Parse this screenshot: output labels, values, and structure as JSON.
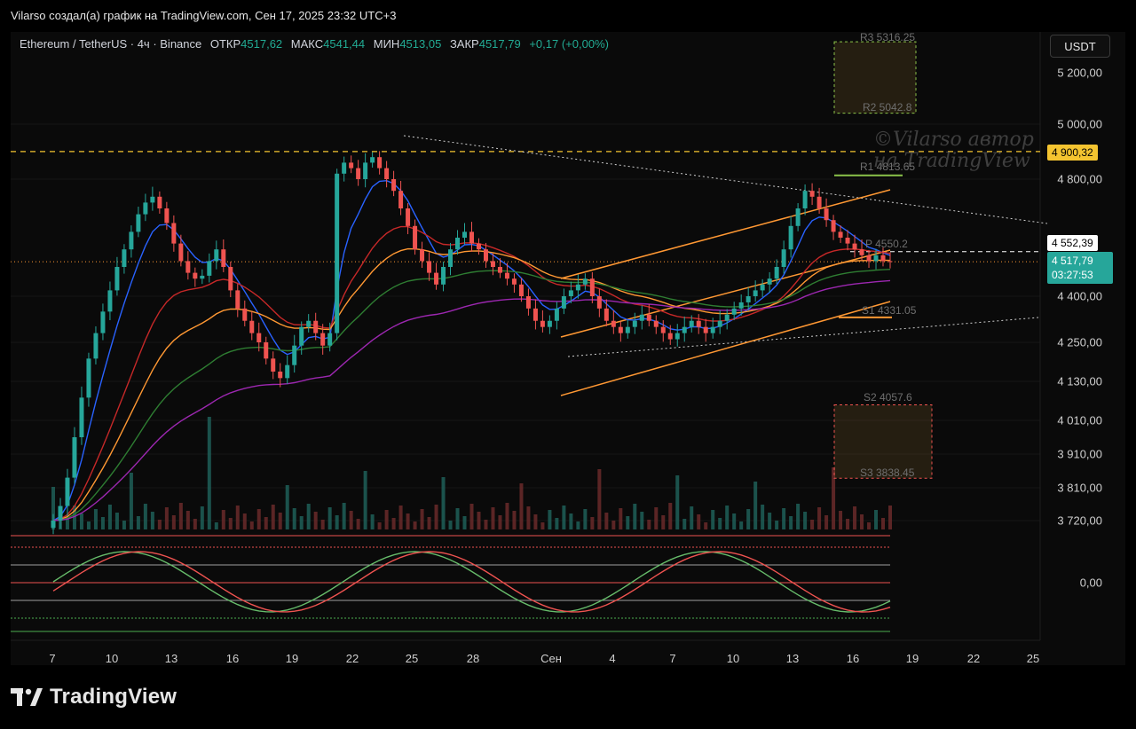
{
  "header": {
    "title": "Vilarso создал(а) график на TradingView.com, Сен 17, 2025 23:32 UTC+3"
  },
  "legend": {
    "symbol": "Ethereum / TetherUS · 4ч · Binance",
    "open_label": "ОТКР",
    "open": "4517,62",
    "high_label": "МАКС",
    "high": "4541,44",
    "low_label": "МИН",
    "low": "4513,05",
    "close_label": "ЗАКР",
    "close": "4517,79",
    "change": "+0,17 (+0,00%)"
  },
  "currency_button": "USDT",
  "price_labels": [
    "5 200,00",
    "5 000,00",
    "4 800,00",
    "4 400,00",
    "4 250,00",
    "4 130,00",
    "4 010,00",
    "3 910,00",
    "3 810,00",
    "3 720,00"
  ],
  "oscillator_label": "0,00",
  "badges": {
    "resistance_line": "4 900,32",
    "crosshair": "4 552,39",
    "last_price": "4 517,79",
    "countdown": "03:27:53"
  },
  "levels": {
    "r3": "R3 5316.25",
    "r2": "R2 5042.8",
    "r1": "R1 4813.65",
    "pivot": "P 4550.2",
    "s1": "S1 4331.05",
    "s2": "S2 4057.6",
    "s3": "S3 3838.45"
  },
  "watermark": {
    "line1": "©Vilarso автор",
    "line2": "на TradingView"
  },
  "x_labels": [
    "7",
    "10",
    "13",
    "16",
    "19",
    "22",
    "25",
    "28",
    "Сен",
    "4",
    "7",
    "10",
    "13",
    "16",
    "19",
    "22",
    "25"
  ],
  "brand": "TradingView",
  "colors": {
    "up": "#26a69a",
    "down": "#ef5350",
    "accent_yellow": "#f4c430",
    "orange_channel": "#ff9833",
    "ema_blue": "#2962ff",
    "ema_purple": "#9c27b0"
  },
  "chart_data": {
    "type": "candlestick",
    "symbol": "Ethereum / TetherUS",
    "timeframe": "4ч",
    "exchange": "Binance",
    "y_ticks": [
      5200,
      5000,
      4800,
      4400,
      4250,
      4130,
      4010,
      3910,
      3810,
      3720
    ],
    "key_levels": {
      "horizontal_resistance": 4900.32,
      "last_price": 4517.79,
      "crosshair": 4552.39
    },
    "pivots": {
      "R3": 5316.25,
      "R2": 5042.8,
      "R1": 4813.65,
      "P": 4550.2,
      "S1": 4331.05,
      "S2": 4057.6,
      "S3": 3838.45
    },
    "x_ticks": [
      "7",
      "10",
      "13",
      "16",
      "19",
      "22",
      "25",
      "28",
      "Сен",
      "4",
      "7",
      "10",
      "13",
      "16",
      "19",
      "22",
      "25"
    ],
    "closes_approx": [
      3720,
      3760,
      3840,
      3960,
      4080,
      4200,
      4280,
      4350,
      4420,
      4500,
      4560,
      4620,
      4680,
      4720,
      4740,
      4700,
      4650,
      4580,
      4520,
      4480,
      4460,
      4470,
      4520,
      4560,
      4500,
      4420,
      4360,
      4320,
      4280,
      4250,
      4200,
      4160,
      4140,
      4180,
      4240,
      4300,
      4320,
      4280,
      4240,
      4280,
      4820,
      4860,
      4840,
      4800,
      4860,
      4880,
      4840,
      4800,
      4760,
      4700,
      4640,
      4560,
      4520,
      4480,
      4440,
      4500,
      4560,
      4600,
      4620,
      4580,
      4560,
      4520,
      4500,
      4480,
      4460,
      4440,
      4400,
      4360,
      4320,
      4300,
      4320,
      4360,
      4400,
      4420,
      4440,
      4460,
      4400,
      4360,
      4320,
      4300,
      4280,
      4300,
      4320,
      4340,
      4320,
      4300,
      4280,
      4260,
      4280,
      4300,
      4320,
      4300,
      4280,
      4300,
      4320,
      4340,
      4360,
      4380,
      4400,
      4420,
      4440,
      4460,
      4500,
      4560,
      4640,
      4700,
      4760,
      4740,
      4700,
      4660,
      4620,
      4600,
      4580,
      4560,
      4540,
      4520,
      4540,
      4520,
      4518
    ]
  }
}
